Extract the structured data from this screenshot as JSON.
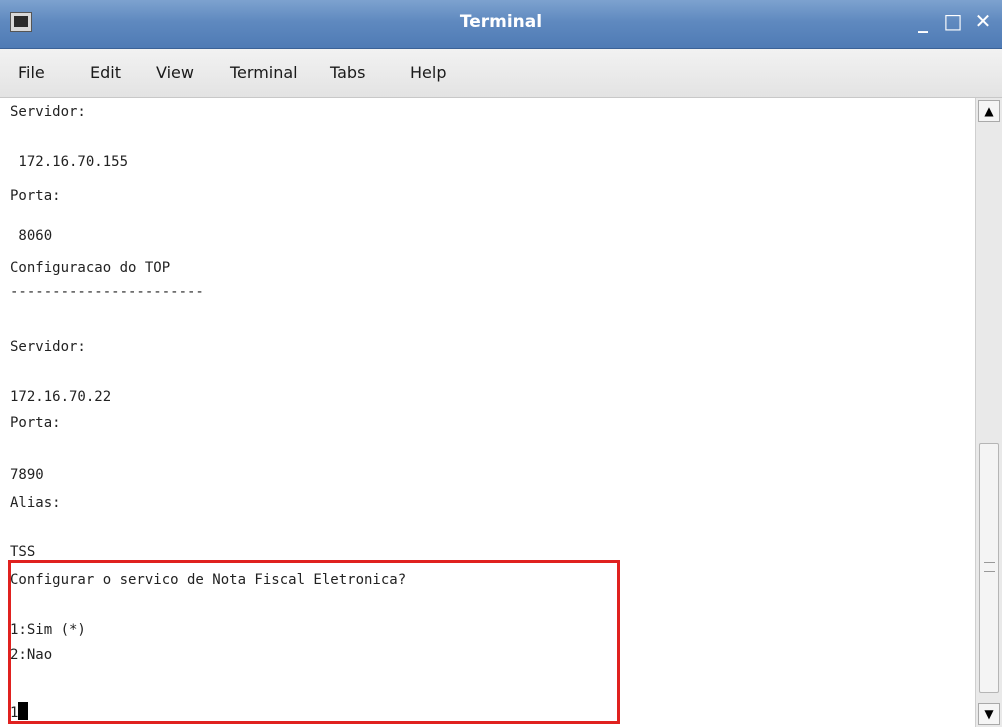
{
  "window": {
    "title": "Terminal",
    "icon": "terminal-app-icon"
  },
  "window_buttons": {
    "minimize": "_",
    "maximize": "□",
    "close": "✕"
  },
  "menu": [
    "File",
    "Edit",
    "View",
    "Terminal",
    "Tabs",
    "Help"
  ],
  "terminal": {
    "lines": [
      "Servidor:",
      " 172.16.70.155",
      "Porta:",
      " 8060",
      "Configuracao do TOP",
      "-----------------------",
      "Servidor:",
      "172.16.70.22",
      "Porta:",
      "7890",
      "Alias:",
      "TSS",
      "Configurar o servico de Nota Fiscal Eletronica?",
      "1:Sim (*)",
      "2:Nao",
      "1"
    ]
  },
  "scrollbar": {
    "up": "▲",
    "down": "▼"
  },
  "colors": {
    "titlebar": "#5f89bf",
    "highlight": "#e0211f"
  }
}
